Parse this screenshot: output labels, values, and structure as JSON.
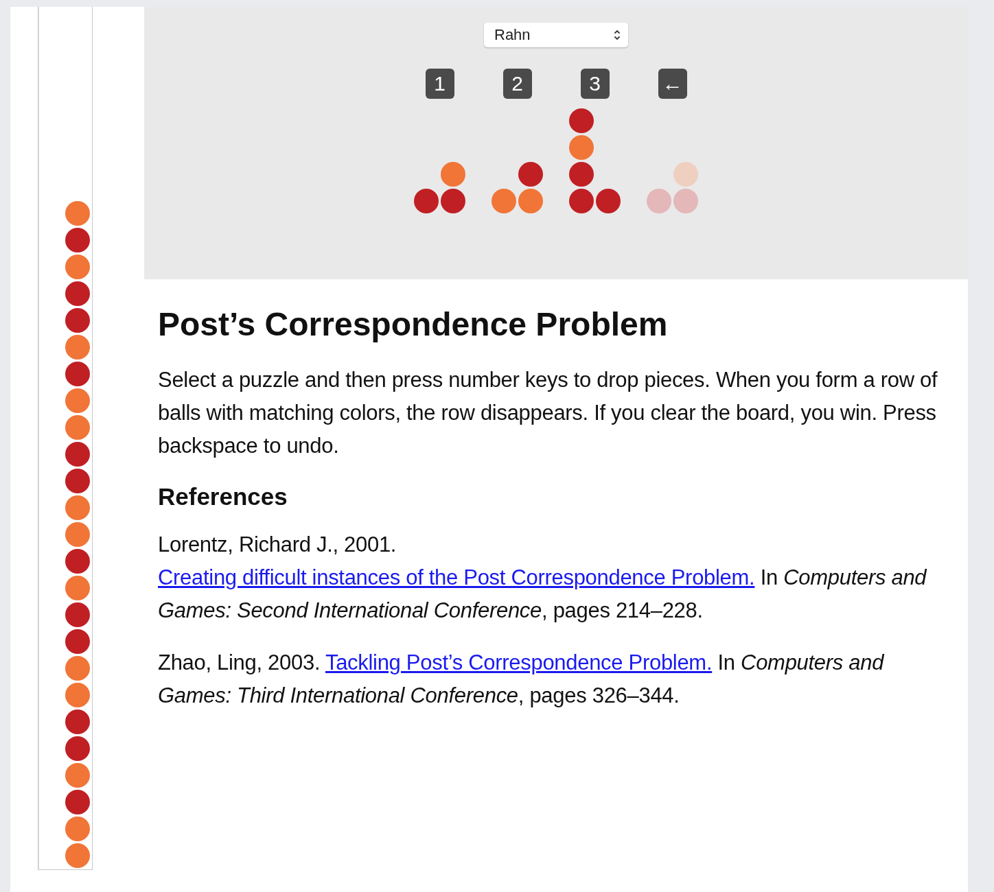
{
  "puzzle_select": {
    "value": "Rahn"
  },
  "keys": [
    {
      "label": "1"
    },
    {
      "label": "2"
    },
    {
      "label": "3"
    },
    {
      "label": "←"
    }
  ],
  "pieces": [
    {
      "rows": [
        [
          null,
          {
            "color": "#f07537"
          }
        ],
        [
          {
            "color": "#c01f24"
          },
          {
            "color": "#c01f24"
          }
        ]
      ]
    },
    {
      "rows": [
        [
          null,
          {
            "color": "#c01f24"
          }
        ],
        [
          {
            "color": "#f07537"
          },
          {
            "color": "#f07537"
          }
        ]
      ]
    },
    {
      "rows": [
        [
          {
            "color": "#c01f24"
          },
          null
        ],
        [
          {
            "color": "#f07537"
          },
          null
        ],
        [
          {
            "color": "#c01f24"
          },
          null
        ],
        [
          {
            "color": "#c01f24"
          },
          {
            "color": "#c01f24"
          }
        ]
      ]
    },
    {
      "rows": [
        [
          null,
          {
            "color": "#efcfc0"
          }
        ],
        [
          {
            "color": "#e4b7b8"
          },
          {
            "color": "#e4b7b8"
          }
        ]
      ]
    }
  ],
  "stack": [
    {
      "color": "#f07537"
    },
    {
      "color": "#c01f24"
    },
    {
      "color": "#f07537"
    },
    {
      "color": "#c01f24"
    },
    {
      "color": "#c01f24"
    },
    {
      "color": "#f07537"
    },
    {
      "color": "#c01f24"
    },
    {
      "color": "#f07537"
    },
    {
      "color": "#f07537"
    },
    {
      "color": "#c01f24"
    },
    {
      "color": "#c01f24"
    },
    {
      "color": "#f07537"
    },
    {
      "color": "#f07537"
    },
    {
      "color": "#c01f24"
    },
    {
      "color": "#f07537"
    },
    {
      "color": "#c01f24"
    },
    {
      "color": "#c01f24"
    },
    {
      "color": "#f07537"
    },
    {
      "color": "#f07537"
    },
    {
      "color": "#c01f24"
    },
    {
      "color": "#c01f24"
    },
    {
      "color": "#f07537"
    },
    {
      "color": "#c01f24"
    },
    {
      "color": "#f07537"
    },
    {
      "color": "#f07537"
    }
  ],
  "title": "Post’s Correspondence Problem",
  "intro": "Select a puzzle and then press number keys to drop pieces. When you form a row of balls with matching colors, the row disappears. If you clear the board, you win. Press backspace to undo.",
  "references_heading": "References",
  "references": [
    {
      "before": "Lorentz, Richard J., 2001. ",
      "link": "Creating difficult instances of the Post Correspondence Problem.",
      "after": " In *Computers and Games: Second International Conference*, pages 214–228."
    },
    {
      "before": "Zhao, Ling, 2003. ",
      "link": "Tackling Post’s Correspondence Problem.",
      "after": " In *Computers and Games: Third International Conference*, pages 326–344."
    }
  ]
}
